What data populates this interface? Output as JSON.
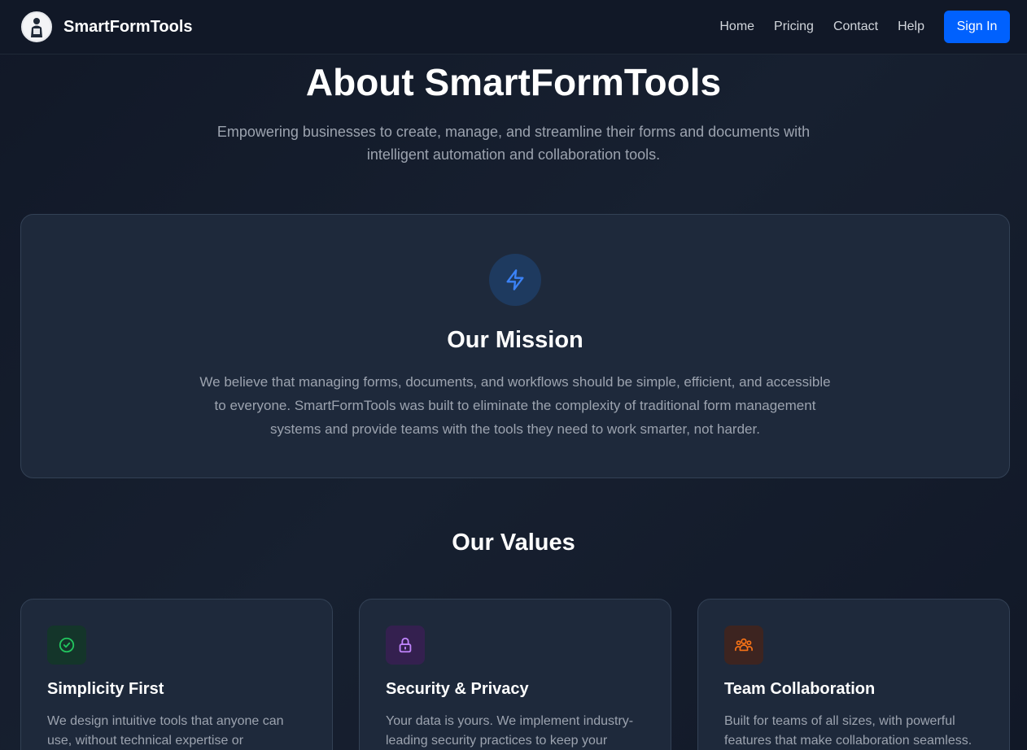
{
  "header": {
    "brand": "SmartFormTools",
    "nav": [
      "Home",
      "Pricing",
      "Contact",
      "Help"
    ],
    "signin_label": "Sign In"
  },
  "hero": {
    "title": "About SmartFormTools",
    "subtitle": "Empowering businesses to create, manage, and streamline their forms and documents with intelligent automation and collaboration tools."
  },
  "mission": {
    "icon": "lightning-bolt-icon",
    "title": "Our Mission",
    "text": "We believe that managing forms, documents, and workflows should be simple, efficient, and accessible to everyone. SmartFormTools was built to eliminate the complexity of traditional form management systems and provide teams with the tools they need to work smarter, not harder."
  },
  "values": {
    "title": "Our Values",
    "cards": [
      {
        "icon": "check-circle-icon",
        "title": "Simplicity First",
        "text": "We design intuitive tools that anyone can use, without technical expertise or",
        "accent": "#22c55e"
      },
      {
        "icon": "lock-icon",
        "title": "Security & Privacy",
        "text": "Your data is yours. We implement industry-leading security practices to keep your",
        "accent": "#c084fc"
      },
      {
        "icon": "users-icon",
        "title": "Team Collaboration",
        "text": "Built for teams of all sizes, with powerful features that make collaboration seamless.",
        "accent": "#f97316"
      }
    ]
  },
  "colors": {
    "primary": "#0061fe",
    "background": "#111827",
    "card": "#1e293b",
    "muted_text": "#9ca3af"
  }
}
